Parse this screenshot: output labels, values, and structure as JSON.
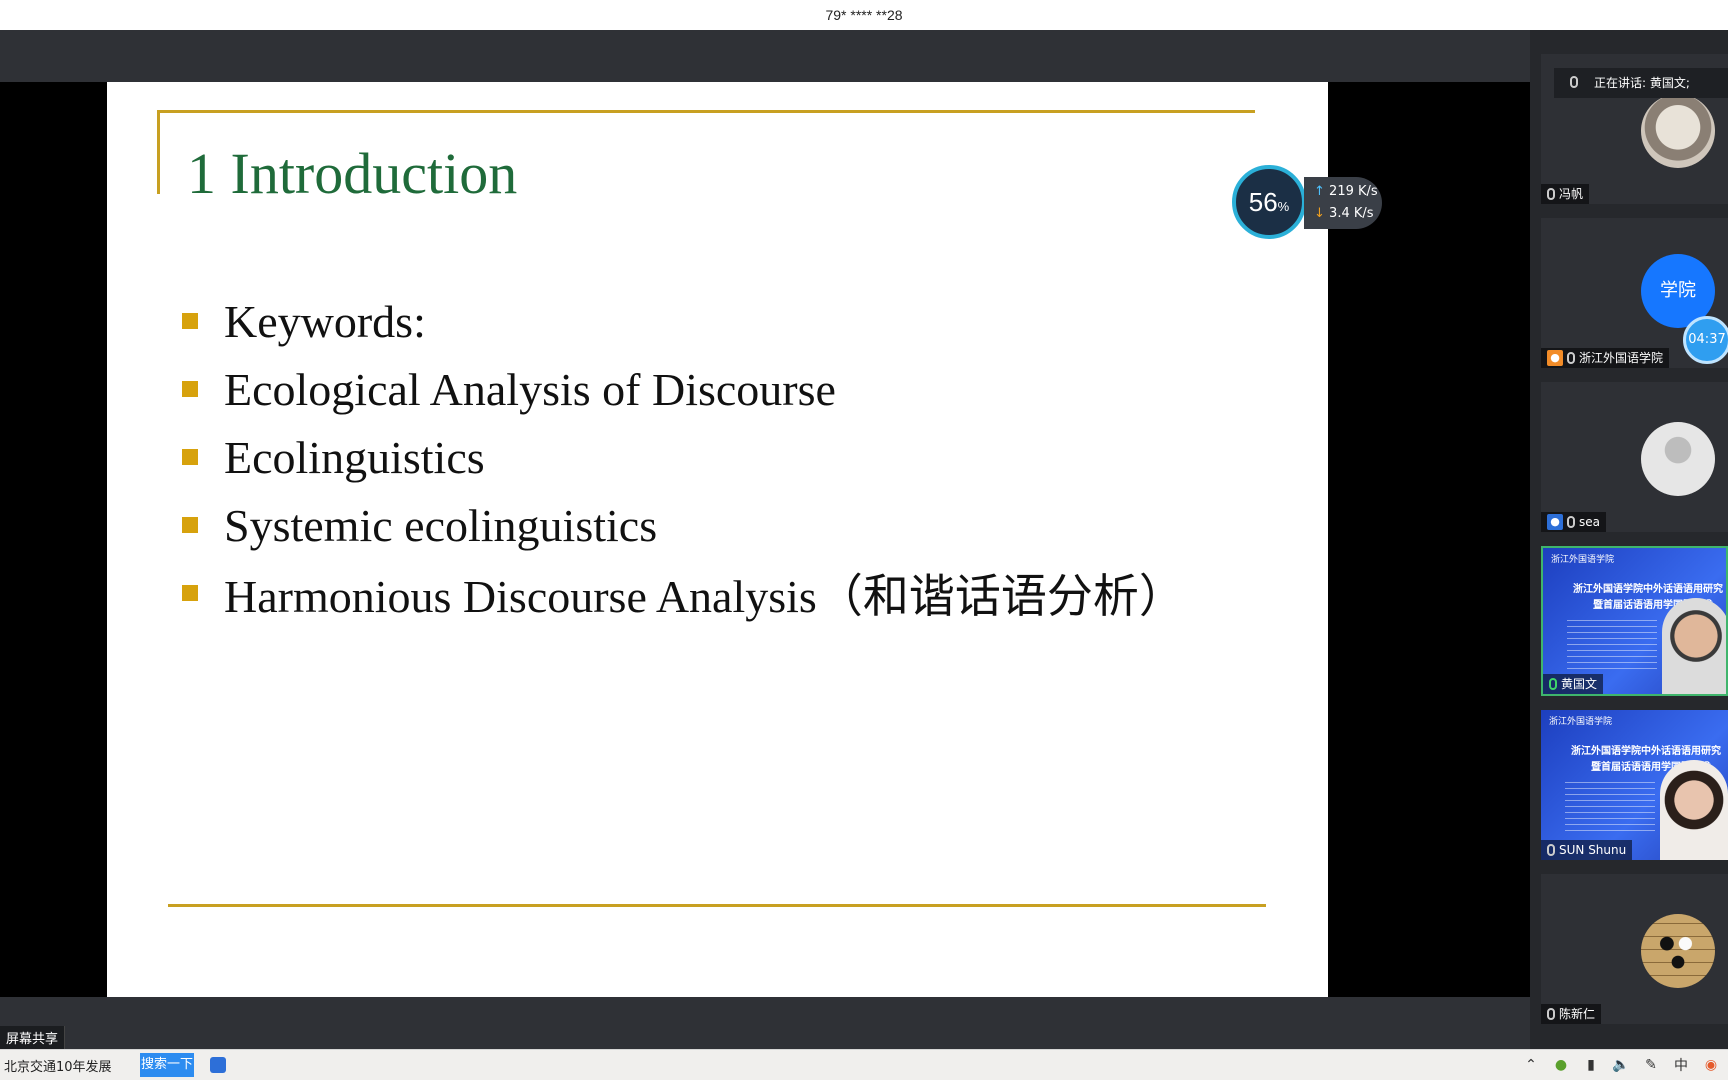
{
  "window": {
    "title": "79* **** **28"
  },
  "slide": {
    "title": "1 Introduction",
    "bullets": [
      "Keywords:",
      "Ecological Analysis of Discourse",
      "Ecolinguistics",
      "Systemic ecolinguistics",
      "Harmonious Discourse Analysis（和谐话语分析）"
    ],
    "accent_color": "#c8a021",
    "title_color": "#1f6b3a"
  },
  "net_monitor": {
    "percent": "56",
    "percent_unit": "%",
    "upload": "219 K/s",
    "download": "3.4 K/s"
  },
  "share_label": "屏幕共享",
  "speaking_now": "正在讲话: 黄国文;",
  "participants": [
    {
      "name": "冯帆"
    },
    {
      "name": "浙江外国语学院",
      "avatar_text": "学院",
      "timer": "04:37"
    },
    {
      "name": "sea"
    },
    {
      "name": "黄国文",
      "banner_line1": "浙江外国语学院中外话语语用研究",
      "banner_line2": "暨首届话语语用学国际学术",
      "banner_org": "浙江外国语学院"
    },
    {
      "name": "SUN Shunu",
      "banner_line1": "浙江外国语学院中外话语语用研究",
      "banner_line2": "暨首届话语语用学国际学术",
      "banner_org": "浙江外国语学院"
    },
    {
      "name": "陈新仁"
    }
  ],
  "taskbar": {
    "news": "北京交通10年发展",
    "search_button": "搜索一下",
    "tray_icons": [
      "chevron-up-icon",
      "network-icon",
      "battery-icon",
      "volume-icon",
      "pen-icon",
      "ime-icon",
      "app-icon"
    ],
    "ime_label": "中"
  }
}
